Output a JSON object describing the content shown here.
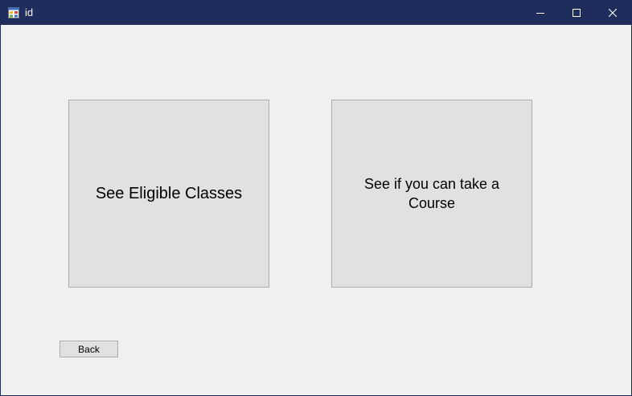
{
  "window": {
    "title": "id",
    "app_icon": "form-app-icon",
    "controls": {
      "minimize_icon": "minimize-icon",
      "maximize_icon": "maximize-icon",
      "close_icon": "close-icon"
    }
  },
  "main": {
    "eligible_classes_label": "See Eligible Classes",
    "take_course_label": "See if you can take a Course",
    "back_label": "Back"
  },
  "colors": {
    "titlebar": "#1f2d5c",
    "client_background": "#f0f0f0",
    "button_face": "#e1e1e1",
    "button_border": "#adadad"
  }
}
